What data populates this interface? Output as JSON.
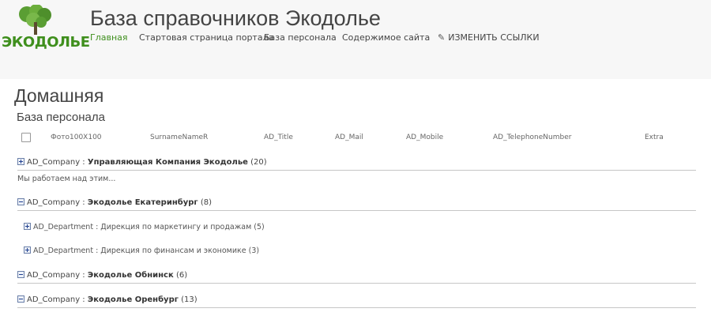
{
  "header": {
    "logo_text": "ЭКОДОЛЬЕ",
    "site_title": "База справочников Экодолье",
    "nav": [
      {
        "label": "Главная",
        "active": true
      },
      {
        "label": "Стартовая страница портала",
        "active": false
      },
      {
        "label": "База персонала",
        "active": false
      },
      {
        "label": "Содержимое сайта",
        "active": false
      }
    ],
    "edit_links_label": "ИЗМЕНИТЬ ССЫЛКИ",
    "edit_icon": "pencil-icon"
  },
  "page_title": "Домашняя",
  "webpart_title": "База персонала",
  "columns": [
    "Фото100X100",
    "SurnameNameR",
    "AD_Title",
    "AD_Mail",
    "AD_Mobile",
    "AD_TelephoneNumber",
    "Extra"
  ],
  "groups": [
    {
      "field": "AD_Company",
      "sep": " : ",
      "value": "Управляющая Компания Экодолье",
      "count": "(20)",
      "expanded": false
    },
    {
      "field": "AD_Company",
      "sep": " : ",
      "value": "Экодолье Екатеринбург",
      "count": "(8)",
      "expanded": true
    },
    {
      "field": "AD_Company",
      "sep": " : ",
      "value": "Экодолье Обнинск",
      "count": "(6)",
      "expanded": true
    },
    {
      "field": "AD_Company",
      "sep": " : ",
      "value": "Экодолье Оренбург",
      "count": "(13)",
      "expanded": true
    }
  ],
  "loading_note": "Мы работаем над этим...",
  "subgroups": [
    {
      "text": "AD_Department : Дирекция по маркетингу и продажам",
      "count": "(5)"
    },
    {
      "text": "AD_Department : Дирекция по финансам и экономике",
      "count": "(3)"
    }
  ],
  "colors": {
    "accent": "#3f8f1d",
    "header_bg": "#f7f7f7",
    "text": "#444444"
  }
}
